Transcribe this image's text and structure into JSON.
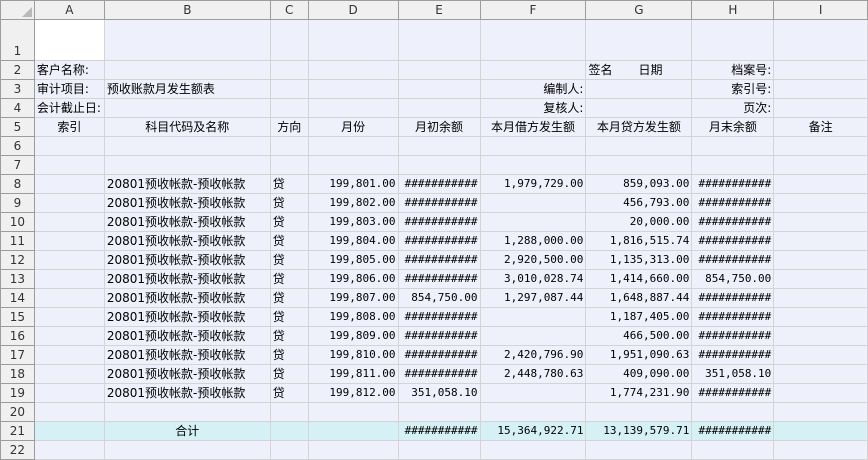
{
  "columns": [
    "A",
    "B",
    "C",
    "D",
    "E",
    "F",
    "G",
    "H",
    "I"
  ],
  "rows": [
    "1",
    "2",
    "3",
    "4",
    "5",
    "6",
    "7",
    "8",
    "9",
    "10",
    "11",
    "12",
    "13",
    "14",
    "15",
    "16",
    "17",
    "18",
    "19",
    "20",
    "21",
    "22"
  ],
  "header": {
    "customer_label": "客户名称:",
    "sign_label": "签名",
    "date_label": "日期",
    "file_no_label": "档案号:",
    "audit_item_label": "审计项目:",
    "audit_item_value": "预收账款月发生额表",
    "preparer_label": "编制人:",
    "index_no_label": "索引号:",
    "cutoff_label": "会计截止日:",
    "reviewer_label": "复核人:",
    "page_label": "页次:"
  },
  "table_headers": [
    "索引",
    "科目代码及名称",
    "方向",
    "月份",
    "月初余额",
    "本月借方发生额",
    "本月贷方发生额",
    "月末余额",
    "备注"
  ],
  "data_rows": [
    {
      "name": "20801预收帐款-预收帐款",
      "dir": "贷",
      "month": "199,801.00",
      "open": "###########",
      "debit": "1,979,729.00",
      "credit": "859,093.00",
      "close": "###########"
    },
    {
      "name": "20801预收帐款-预收帐款",
      "dir": "贷",
      "month": "199,802.00",
      "open": "###########",
      "debit": "",
      "credit": "456,793.00",
      "close": "###########"
    },
    {
      "name": "20801预收帐款-预收帐款",
      "dir": "贷",
      "month": "199,803.00",
      "open": "###########",
      "debit": "",
      "credit": "20,000.00",
      "close": "###########"
    },
    {
      "name": "20801预收帐款-预收帐款",
      "dir": "贷",
      "month": "199,804.00",
      "open": "###########",
      "debit": "1,288,000.00",
      "credit": "1,816,515.74",
      "close": "###########"
    },
    {
      "name": "20801预收帐款-预收帐款",
      "dir": "贷",
      "month": "199,805.00",
      "open": "###########",
      "debit": "2,920,500.00",
      "credit": "1,135,313.00",
      "close": "###########"
    },
    {
      "name": "20801预收帐款-预收帐款",
      "dir": "贷",
      "month": "199,806.00",
      "open": "###########",
      "debit": "3,010,028.74",
      "credit": "1,414,660.00",
      "close": "854,750.00"
    },
    {
      "name": "20801预收帐款-预收帐款",
      "dir": "贷",
      "month": "199,807.00",
      "open": "854,750.00",
      "debit": "1,297,087.44",
      "credit": "1,648,887.44",
      "close": "###########"
    },
    {
      "name": "20801预收帐款-预收帐款",
      "dir": "贷",
      "month": "199,808.00",
      "open": "###########",
      "debit": "",
      "credit": "1,187,405.00",
      "close": "###########"
    },
    {
      "name": "20801预收帐款-预收帐款",
      "dir": "贷",
      "month": "199,809.00",
      "open": "###########",
      "debit": "",
      "credit": "466,500.00",
      "close": "###########"
    },
    {
      "name": "20801预收帐款-预收帐款",
      "dir": "贷",
      "month": "199,810.00",
      "open": "###########",
      "debit": "2,420,796.90",
      "credit": "1,951,090.63",
      "close": "###########"
    },
    {
      "name": "20801预收帐款-预收帐款",
      "dir": "贷",
      "month": "199,811.00",
      "open": "###########",
      "debit": "2,448,780.63",
      "credit": "409,090.00",
      "close": "351,058.10"
    },
    {
      "name": "20801预收帐款-预收帐款",
      "dir": "贷",
      "month": "199,812.00",
      "open": "351,058.10",
      "debit": "",
      "credit": "1,774,231.90",
      "close": "###########"
    }
  ],
  "total": {
    "label": "合计",
    "open": "###########",
    "debit": "15,364,922.71",
    "credit": "13,139,579.71",
    "close": "###########"
  },
  "colors": {
    "header_bg": "#f0f0f0",
    "shade": "#eef0fb",
    "total_row": "#d6f1f6",
    "marker": "#e00000"
  }
}
